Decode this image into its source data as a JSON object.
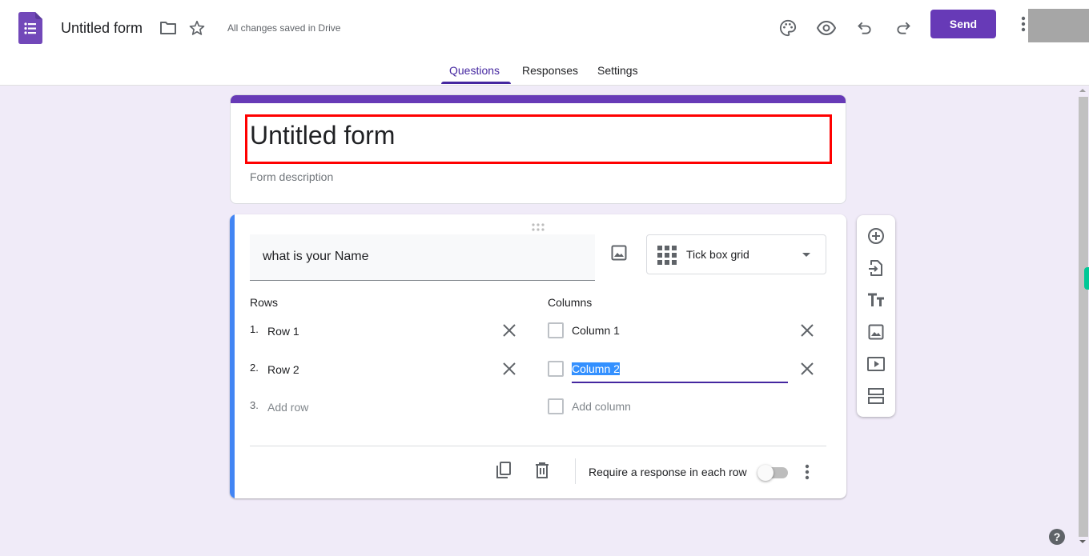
{
  "header": {
    "app_icon": "google-forms-logo",
    "doc_title": "Untitled form",
    "save_status": "All changes saved in Drive",
    "icons": [
      "folder-icon",
      "star-icon",
      "palette-icon",
      "eye-icon",
      "undo-icon",
      "redo-icon",
      "more-vert-icon"
    ],
    "send_label": "Send"
  },
  "tabs": [
    {
      "label": "Questions",
      "active": true
    },
    {
      "label": "Responses",
      "active": false
    },
    {
      "label": "Settings",
      "active": false
    }
  ],
  "form": {
    "title": "Untitled form",
    "description_placeholder": "Form description",
    "accent_color": "#673ab7"
  },
  "question": {
    "title": "what is your Name",
    "type_label": "Tick box grid",
    "rows_label": "Rows",
    "columns_label": "Columns",
    "rows": [
      {
        "num": "1.",
        "text": "Row 1"
      },
      {
        "num": "2.",
        "text": "Row 2"
      }
    ],
    "add_row": {
      "num": "3.",
      "text": "Add row"
    },
    "columns": [
      {
        "text": "Column 1"
      },
      {
        "text": "Column 2",
        "selected": true
      }
    ],
    "add_column": "Add column",
    "require_label": "Require a response in each row",
    "require_enabled": false
  },
  "floating_toolbar": [
    "add-question-icon",
    "import-questions-icon",
    "add-title-icon",
    "add-image-icon",
    "add-video-icon",
    "add-section-icon"
  ],
  "help_label": "?"
}
